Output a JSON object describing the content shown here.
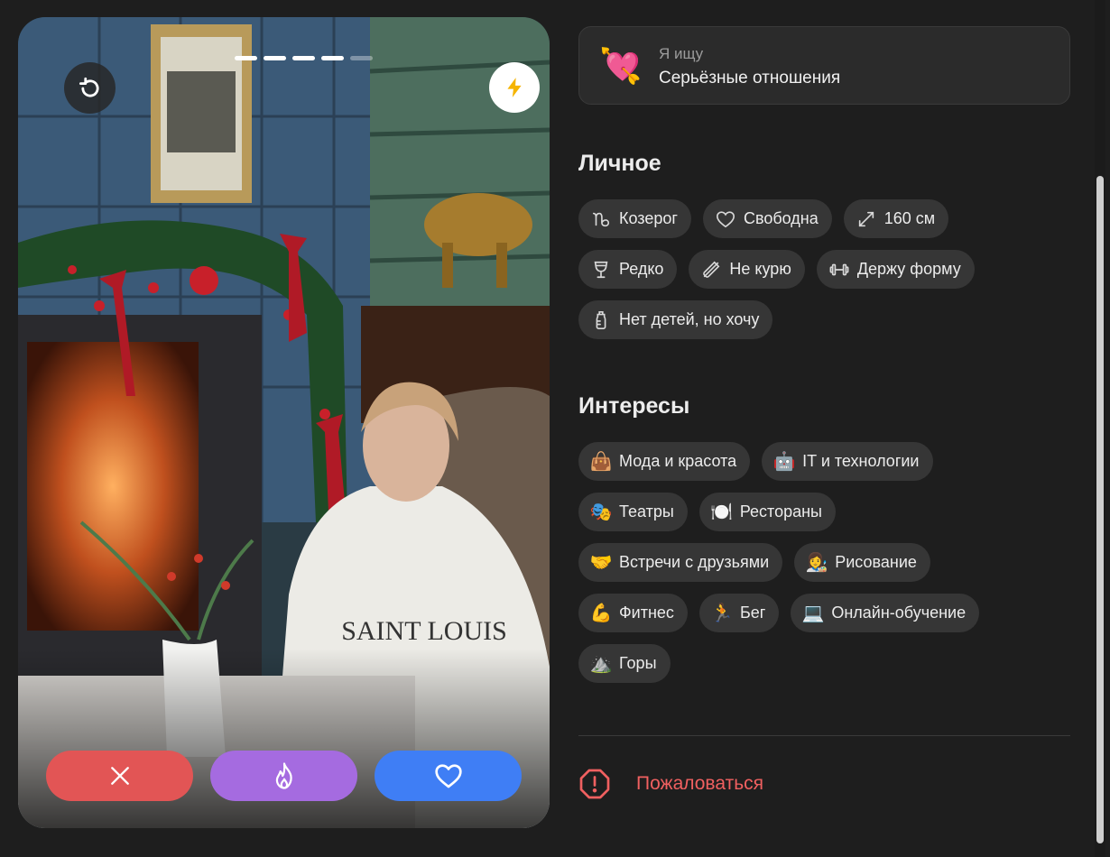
{
  "profile": {
    "photo_count": 5,
    "photo_current": 4
  },
  "looking_for": {
    "emoji": "💘",
    "label": "Я ищу",
    "value": "Серьёзные отношения"
  },
  "personal": {
    "title": "Личное",
    "rows": [
      [
        {
          "icon": "capricorn-icon",
          "label": "Козерог"
        },
        {
          "icon": "heart-outline-icon",
          "label": "Свободна"
        },
        {
          "icon": "height-icon",
          "label": "160 см"
        }
      ],
      [
        {
          "icon": "wine-glass-icon",
          "label": "Редко"
        },
        {
          "icon": "no-smoking-icon",
          "label": "Не курю"
        },
        {
          "icon": "dumbbell-icon",
          "label": "Держу форму"
        }
      ],
      [
        {
          "icon": "baby-bottle-icon",
          "label": "Нет детей, но хочу"
        }
      ]
    ]
  },
  "interests": {
    "title": "Интересы",
    "rows": [
      [
        {
          "emoji": "👜",
          "label": "Мода и красота"
        },
        {
          "emoji": "🤖",
          "label": "IT и технологии"
        }
      ],
      [
        {
          "emoji": "🎭",
          "label": "Театры"
        },
        {
          "emoji": "🍽️",
          "label": "Рестораны"
        }
      ],
      [
        {
          "emoji": "🤝",
          "label": "Встречи с друзьями"
        },
        {
          "emoji": "👩‍🎨",
          "label": "Рисование"
        }
      ],
      [
        {
          "emoji": "💪",
          "label": "Фитнес"
        },
        {
          "emoji": "🏃",
          "label": "Бег"
        },
        {
          "emoji": "💻",
          "label": "Онлайн-обучение"
        }
      ],
      [
        {
          "emoji": "⛰️",
          "label": "Горы"
        }
      ]
    ]
  },
  "report": {
    "label": "Пожаловаться"
  },
  "colors": {
    "dislike": "#e25555",
    "superlike": "#a56be0",
    "like": "#3f7ef5",
    "report": "#f06060",
    "boost": "#f5b400"
  }
}
